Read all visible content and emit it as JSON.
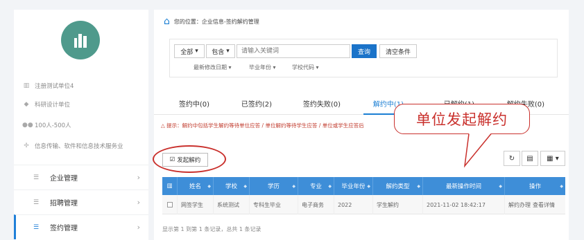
{
  "sidebar": {
    "info": [
      {
        "icon": "building-icon",
        "text": "注册测试单位4"
      },
      {
        "icon": "graduation-cap-icon",
        "text": "科研设计单位"
      },
      {
        "icon": "users-icon",
        "text": "100人-500人"
      },
      {
        "icon": "industry-icon",
        "text": "信息传输、软件和信息技术服务业"
      }
    ],
    "nav": [
      {
        "label": "企业管理"
      },
      {
        "label": "招聘管理"
      },
      {
        "label": "签约管理"
      }
    ]
  },
  "breadcrumb": "您的位置：企业信息-签约解约管理",
  "filter": {
    "scope": "全部",
    "match": "包含",
    "search_placeholder": "请输入关键词",
    "query_label": "查询",
    "clear_label": "清空条件",
    "subfilters": [
      "最新修改日期",
      "毕业年份",
      "学校代码"
    ]
  },
  "tabs": [
    "签约中(0)",
    "已签约(2)",
    "签约失败(0)",
    "解约中(1)",
    "已解约(1)",
    "解约失败(0)"
  ],
  "active_tab": "解约中(1)",
  "tip": "提示：解约中包括学生解约等待单位应答 / 单位解约等待学生应答 / 单位或学生应答后",
  "launch_button": "发起解约",
  "table": {
    "headers": [
      "姓名",
      "学校",
      "学历",
      "专业",
      "毕业年份",
      "解约类型",
      "最新操作时间",
      "操作"
    ],
    "rows": [
      {
        "name": "网签学生",
        "school": "系统测试",
        "degree": "专科生毕业",
        "major": "电子商务",
        "year": "2022",
        "type": "学生解约",
        "time": "2021-11-02 18:42:17",
        "action1": "解约办理",
        "action2": "查看详情"
      }
    ]
  },
  "footer": "显示第 1 到第 1 条记录，总共 1 条记录",
  "callout": "单位发起解约",
  "colors": {
    "primary": "#1a73c9",
    "header": "#3e8ed8",
    "annotation": "#c9302c",
    "avatar": "#4f9a8c"
  }
}
